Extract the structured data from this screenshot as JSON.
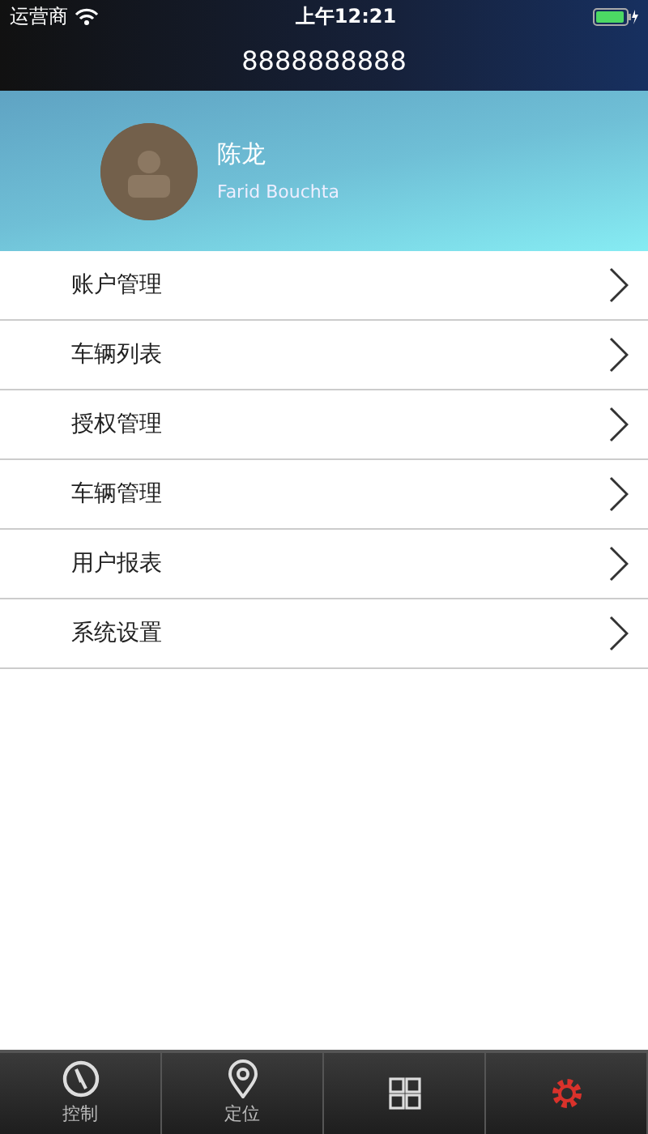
{
  "status_bar": {
    "carrier": "运营商",
    "time": "上午12:21"
  },
  "title": "8888888888",
  "profile": {
    "name": "陈龙",
    "subtitle": "Farid Bouchta"
  },
  "menu": [
    {
      "label": "账户管理"
    },
    {
      "label": "车辆列表"
    },
    {
      "label": "授权管理"
    },
    {
      "label": "车辆管理"
    },
    {
      "label": "用户报表"
    },
    {
      "label": "系统设置"
    }
  ],
  "tabs": [
    {
      "kind": "compass",
      "label": "控制",
      "selected": false
    },
    {
      "kind": "pin",
      "label": "定位",
      "selected": false
    },
    {
      "kind": "grid",
      "selected": false
    },
    {
      "kind": "gear",
      "selected": true
    }
  ]
}
